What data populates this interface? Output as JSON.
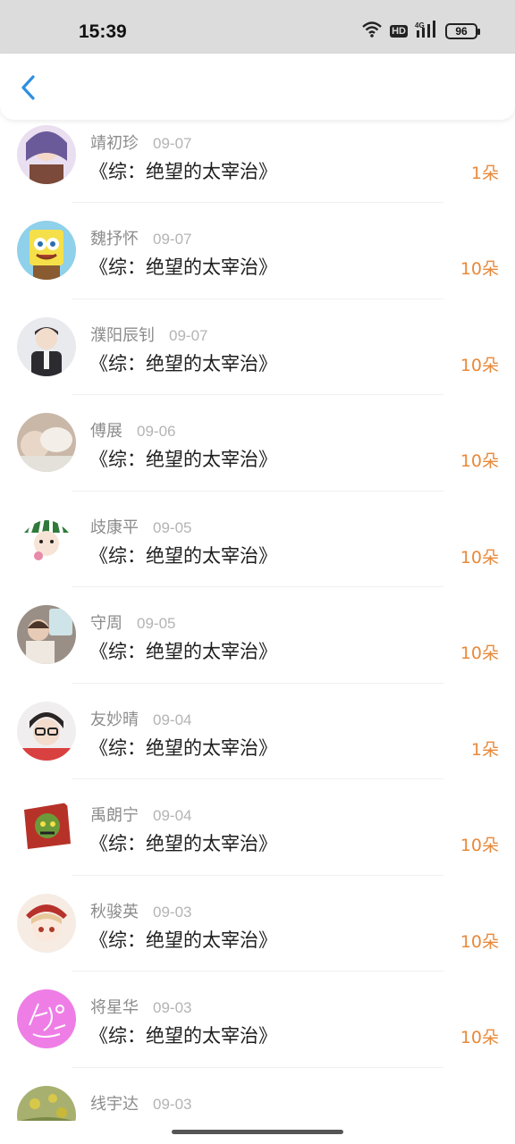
{
  "status_bar": {
    "time": "15:39",
    "battery": "96",
    "network": "4G",
    "hd": "HD"
  },
  "nav": {
    "back_icon": "chevron-left-icon",
    "accent": "#2f8fe0"
  },
  "colors": {
    "count": "#e8893a",
    "name": "#8c8c8c",
    "date": "#b4b4b4"
  },
  "items": [
    {
      "name": "靖初珍",
      "date": "09-07",
      "title": "《综：绝望的太宰治》",
      "count": "1朵"
    },
    {
      "name": "魏抒怀",
      "date": "09-07",
      "title": "《综：绝望的太宰治》",
      "count": "10朵"
    },
    {
      "name": "濮阳辰钊",
      "date": "09-07",
      "title": "《综：绝望的太宰治》",
      "count": "10朵"
    },
    {
      "name": "傅展",
      "date": "09-06",
      "title": "《综：绝望的太宰治》",
      "count": "10朵"
    },
    {
      "name": "歧康平",
      "date": "09-05",
      "title": "《综：绝望的太宰治》",
      "count": "10朵"
    },
    {
      "name": "守周",
      "date": "09-05",
      "title": "《综：绝望的太宰治》",
      "count": "10朵"
    },
    {
      "name": "友妙晴",
      "date": "09-04",
      "title": "《综：绝望的太宰治》",
      "count": "1朵"
    },
    {
      "name": "禹朗宁",
      "date": "09-04",
      "title": "《综：绝望的太宰治》",
      "count": "10朵"
    },
    {
      "name": "秋骏英",
      "date": "09-03",
      "title": "《综：绝望的太宰治》",
      "count": "10朵"
    },
    {
      "name": "将星华",
      "date": "09-03",
      "title": "《综：绝望的太宰治》",
      "count": "10朵"
    },
    {
      "name": "线宇达",
      "date": "09-03",
      "title": "",
      "count": ""
    }
  ]
}
